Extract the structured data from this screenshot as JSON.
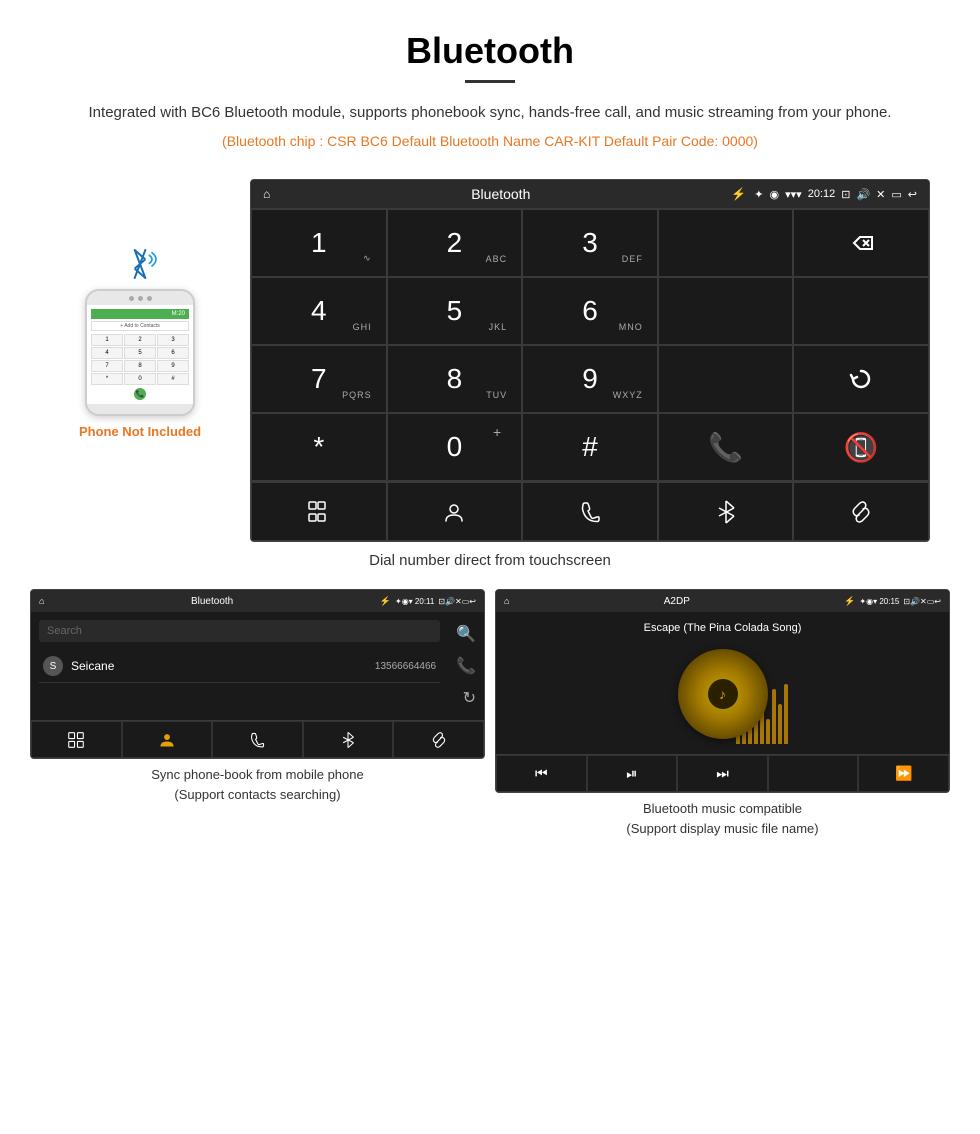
{
  "header": {
    "title": "Bluetooth",
    "description": "Integrated with BC6 Bluetooth module, supports phonebook sync, hands-free call, and music streaming from your phone.",
    "specs": "(Bluetooth chip : CSR BC6    Default Bluetooth Name CAR-KIT    Default Pair Code: 0000)"
  },
  "phone_mockup": {
    "not_included_text": "Phone Not Included",
    "green_bar_text": "M:20",
    "add_contacts": "+ Add to Contacts",
    "keys": [
      "1",
      "2",
      "3",
      "4",
      "5",
      "6",
      "7",
      "8",
      "9",
      "*",
      "0",
      "#"
    ]
  },
  "dial_screen": {
    "statusbar": {
      "home_icon": "⌂",
      "title": "Bluetooth",
      "usb_icon": "⚡",
      "time": "20:12",
      "camera_icon": "📷",
      "volume_icon": "🔊",
      "close_icon": "✕",
      "back_icon": "↩"
    },
    "keys": [
      {
        "num": "1",
        "sub": "∞",
        "col": 1
      },
      {
        "num": "2",
        "sub": "ABC",
        "col": 2
      },
      {
        "num": "3",
        "sub": "DEF",
        "col": 3
      },
      {
        "num": "4",
        "sub": "GHI",
        "col": 1
      },
      {
        "num": "5",
        "sub": "JKL",
        "col": 2
      },
      {
        "num": "6",
        "sub": "MNO",
        "col": 3
      },
      {
        "num": "7",
        "sub": "PQRS",
        "col": 1
      },
      {
        "num": "8",
        "sub": "TUV",
        "col": 2
      },
      {
        "num": "9",
        "sub": "WXYZ",
        "col": 3
      }
    ],
    "caption": "Dial number direct from touchscreen"
  },
  "phonebook_screen": {
    "statusbar_title": "Bluetooth",
    "search_placeholder": "Search",
    "contact_name": "Seicane",
    "contact_number": "13566664466",
    "caption_line1": "Sync phone-book from mobile phone",
    "caption_line2": "(Support contacts searching)"
  },
  "a2dp_screen": {
    "statusbar_title": "A2DP",
    "song_title": "Escape (The Pina Colada Song)",
    "caption_line1": "Bluetooth music compatible",
    "caption_line2": "(Support display music file name)"
  },
  "colors": {
    "accent_orange": "#e87722",
    "screen_bg": "#1a1a1a",
    "statusbar_bg": "#2a2a2a",
    "green_call": "#4caf50",
    "red_hangup": "#f44336",
    "gold_music": "#c8a800",
    "seicane_watermark": "rgba(200,160,0,0.5)"
  }
}
